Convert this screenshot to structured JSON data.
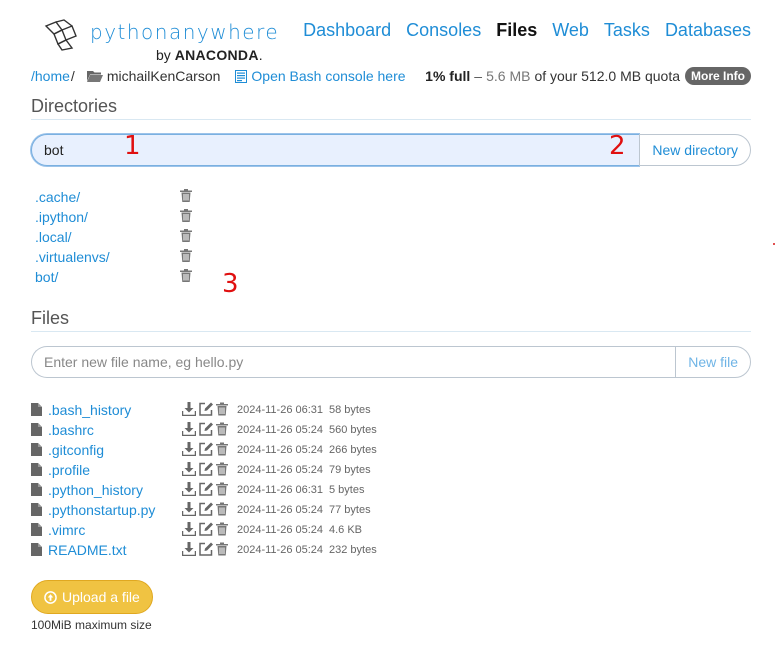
{
  "header": {
    "logo_text": "pythonanywhere",
    "by": "by",
    "brand": "ANACONDA",
    "brand_dot": ".",
    "nav": [
      {
        "label": "Dashboard",
        "active": false
      },
      {
        "label": "Consoles",
        "active": false
      },
      {
        "label": "Files",
        "active": true
      },
      {
        "label": "Web",
        "active": false
      },
      {
        "label": "Tasks",
        "active": false
      },
      {
        "label": "Databases",
        "active": false
      }
    ]
  },
  "breadcrumb": {
    "home": "/home",
    "sep": "/",
    "user": "michailKenCarson",
    "console_link": "Open Bash console here"
  },
  "quota": {
    "percent": "1% full",
    "dash": "–",
    "used": "5.6 MB",
    "rest": "of your 512.0 MB quota",
    "more_info": "More Info"
  },
  "directories": {
    "heading": "Directories",
    "input_value": "bot",
    "button": "New directory",
    "items": [
      ".cache/",
      ".ipython/",
      ".local/",
      ".virtualenvs/",
      "bot/"
    ]
  },
  "annotations": [
    "1",
    "2",
    "3"
  ],
  "files": {
    "heading": "Files",
    "placeholder": "Enter new file name, eg hello.py",
    "button": "New file",
    "items": [
      {
        "name": ".bash_history",
        "date": "2024-11-26 06:31",
        "size": "58 bytes"
      },
      {
        "name": ".bashrc",
        "date": "2024-11-26 05:24",
        "size": "560 bytes"
      },
      {
        "name": ".gitconfig",
        "date": "2024-11-26 05:24",
        "size": "266 bytes"
      },
      {
        "name": ".profile",
        "date": "2024-11-26 05:24",
        "size": "79 bytes"
      },
      {
        "name": ".python_history",
        "date": "2024-11-26 06:31",
        "size": "5 bytes"
      },
      {
        "name": ".pythonstartup.py",
        "date": "2024-11-26 05:24",
        "size": "77 bytes"
      },
      {
        "name": ".vimrc",
        "date": "2024-11-26 05:24",
        "size": "4.6 KB"
      },
      {
        "name": "README.txt",
        "date": "2024-11-26 05:24",
        "size": "232 bytes"
      }
    ]
  },
  "upload": {
    "button": "Upload a file",
    "note": "100MiB maximum size"
  },
  "colors": {
    "link": "#1f8dd6",
    "upload": "#f0c342",
    "annotation": "#e01010",
    "badge": "#666666"
  }
}
